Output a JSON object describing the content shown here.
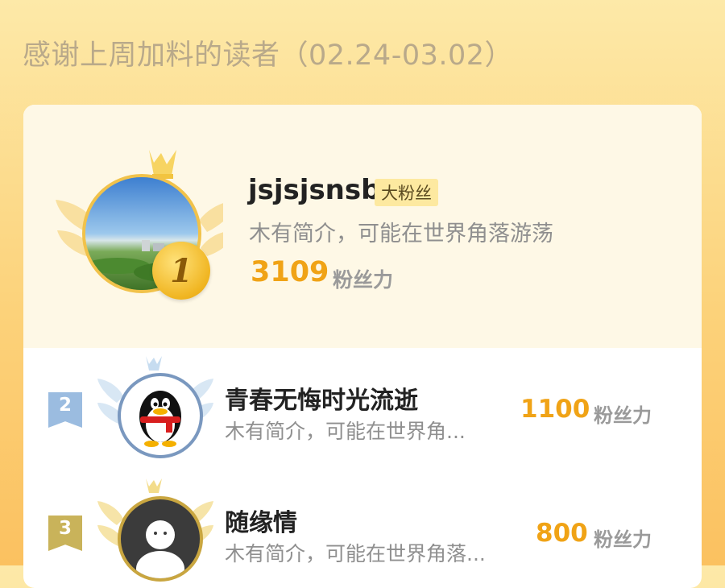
{
  "header": {
    "title": "感谢上周加料的读者（02.24-03.02）"
  },
  "leaderboard": [
    {
      "rank": "1",
      "name": "jsjsjsnsb",
      "badge": "大粉丝",
      "bio": "木有简介，可能在世界角落游荡",
      "score": "3109",
      "unit": "粉丝力"
    },
    {
      "rank": "2",
      "name": "青春无悔时光流逝",
      "bio": "木有简介，可能在世界角...",
      "score": "1100",
      "unit": "粉丝力"
    },
    {
      "rank": "3",
      "name": "随缘情",
      "bio": "木有简介，可能在世界角落...",
      "score": "800",
      "unit": "粉丝力"
    }
  ],
  "colors": {
    "accent": "#f0a316",
    "rank2": "#9bbce0",
    "rank3": "#c9b35a"
  }
}
